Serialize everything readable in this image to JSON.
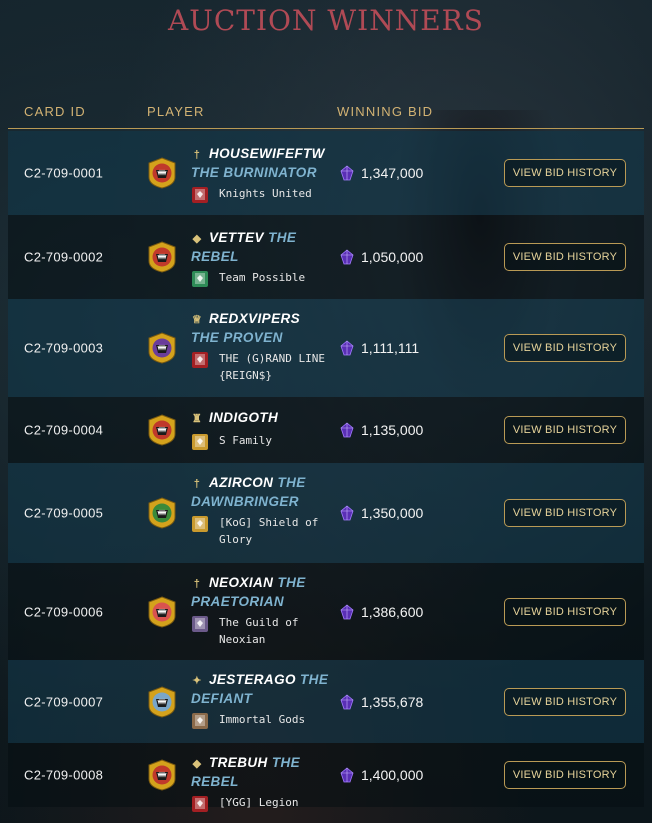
{
  "page": {
    "title": "AUCTION WINNERS",
    "columns": {
      "card_id": "CARD ID",
      "player": "PLAYER",
      "winning_bid": "WINNING BID"
    },
    "button_label": "VIEW BID HISTORY"
  },
  "colors": {
    "title": "#b04a55",
    "accent_gold": "#b99a55",
    "player_title": "#7fb3cf"
  },
  "rows": [
    {
      "card_id": "C2-709-0001",
      "name": "HOUSEWIFEFTW",
      "title": "THE BURNINATOR",
      "guild": "Knights United",
      "bid": "1,347,000",
      "avatar_color": "#c0392b",
      "guild_color": "#a31f23",
      "rank_icon": "sword-rank-icon"
    },
    {
      "card_id": "C2-709-0002",
      "name": "VETTEV",
      "title": "THE REBEL",
      "guild": "Team Possible",
      "bid": "1,050,000",
      "avatar_color": "#c0392b",
      "guild_color": "#2e8b57",
      "rank_icon": "shield-rank-icon"
    },
    {
      "card_id": "C2-709-0003",
      "name": "REDXVIPERS",
      "title": "THE PROVEN",
      "guild": "THE (G)RAND LINE {REIGN$}",
      "bid": "1,111,111",
      "avatar_color": "#6a3d9a",
      "guild_color": "#a31f23",
      "rank_icon": "crown-rank-icon"
    },
    {
      "card_id": "C2-709-0004",
      "name": "INDIGOTH",
      "title": "",
      "guild": "S Family",
      "bid": "1,135,000",
      "avatar_color": "#c0392b",
      "guild_color": "#c99a2e",
      "rank_icon": "tower-rank-icon"
    },
    {
      "card_id": "C2-709-0005",
      "name": "AZIRCON",
      "title": "THE DAWNBRINGER",
      "guild": "[KoG] Shield of Glory",
      "bid": "1,350,000",
      "avatar_color": "#3a8a3a",
      "guild_color": "#c99a2e",
      "rank_icon": "sword-rank-icon"
    },
    {
      "card_id": "C2-709-0006",
      "name": "NEOXIAN",
      "title": "THE PRAETORIAN",
      "guild": "The Guild of Neoxian",
      "bid": "1,386,600",
      "avatar_color": "#d9534f",
      "guild_color": "#6b5a8a",
      "rank_icon": "sword-rank-icon"
    },
    {
      "card_id": "C2-709-0007",
      "name": "JESTERAGO",
      "title": "THE DEFIANT",
      "guild": "Immortal Gods",
      "bid": "1,355,678",
      "avatar_color": "#7aa6c8",
      "guild_color": "#8a6a4a",
      "rank_icon": "star-rank-icon"
    },
    {
      "card_id": "C2-709-0008",
      "name": "TREBUH",
      "title": "THE REBEL",
      "guild": "[YGG] Legion",
      "bid": "1,400,000",
      "avatar_color": "#c0392b",
      "guild_color": "#a31f23",
      "rank_icon": "shield-rank-icon"
    }
  ]
}
